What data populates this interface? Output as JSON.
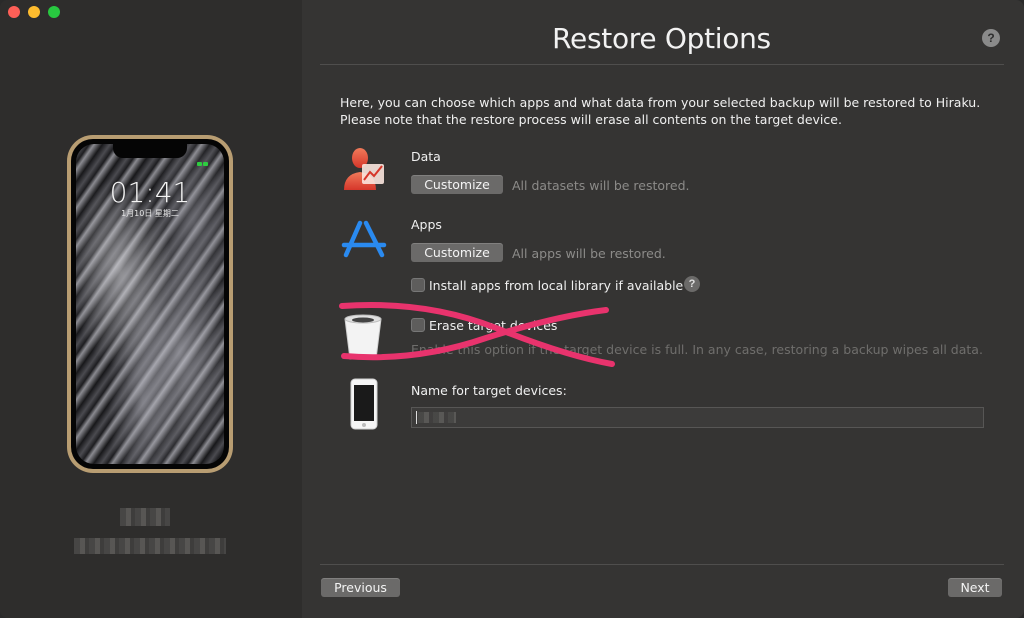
{
  "window": {
    "title": "Restore Options"
  },
  "device": {
    "lock_time": "01:41",
    "lock_date": "1月10日 星期二"
  },
  "intro_text": "Here, you can choose which apps and what data from your selected backup will be restored to Hiraku. Please note that the restore process will erase all contents on the target device.",
  "data_section": {
    "label": "Data",
    "button": "Customize",
    "hint": "All datasets will be restored.",
    "icon": "person-chart-icon"
  },
  "apps_section": {
    "label": "Apps",
    "button": "Customize",
    "hint": "All apps will be restored.",
    "icon": "app-store-icon",
    "install_local_label": "Install apps from local library if available",
    "install_local_checked": false
  },
  "erase_section": {
    "label": "Erase target devices",
    "hint": "Enable this option if the target device is full. In any case, restoring a backup wipes all data.",
    "checked": false,
    "icon": "trash-icon",
    "crossed_out": true,
    "cross_color": "#e8336d"
  },
  "name_section": {
    "label": "Name for target devices:",
    "icon": "iphone-icon",
    "value": ""
  },
  "footer": {
    "previous": "Previous",
    "next": "Next"
  },
  "colors": {
    "background": "#353433",
    "sidebar": "#2e2d2c",
    "button": "#6b6a69",
    "accent_data": "#e8533a",
    "accent_apps": "#1e7be0"
  }
}
